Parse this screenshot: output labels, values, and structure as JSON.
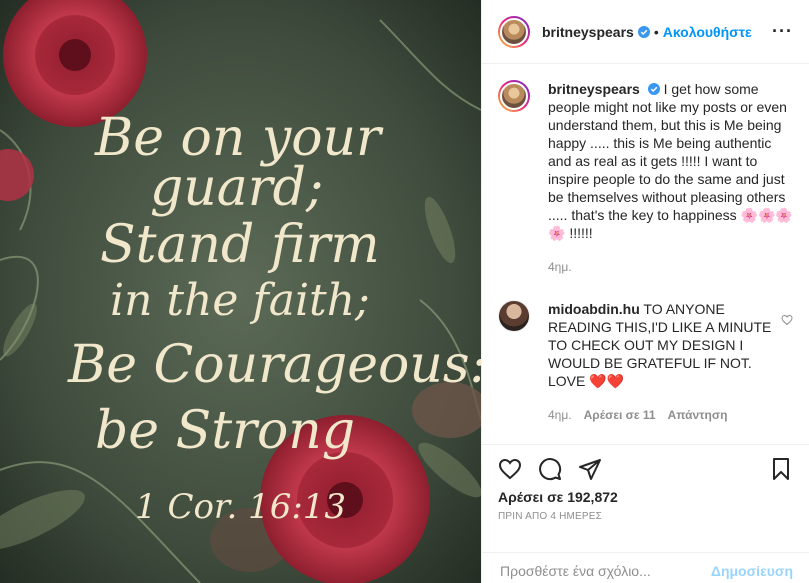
{
  "image": {
    "lines": [
      "Be on your",
      "guard;",
      "Stand firm",
      "in the faith;",
      "Be Courageous:",
      "be Strong",
      "1 Cor. 16:13"
    ],
    "colors": {
      "background": "#3d4a3c",
      "lettering": "#f1e8cc",
      "flower": "#b8283c"
    }
  },
  "header": {
    "username": "britneyspears",
    "verified_icon": "verified-badge-icon",
    "dot": "•",
    "follow_label": "Ακολουθήστε",
    "more_label": "···"
  },
  "caption": {
    "username": "britneyspears",
    "text": "I get how some people might not like my posts or even understand them, but this is Me being happy ..... this is Me being authentic and as real as it gets !!!!! I want to inspire people to do the same and just be themselves without pleasing others ..... that's the key to happiness 🌸🌸🌸🌸 !!!!!!",
    "time": "4ημ."
  },
  "comment": {
    "username": "midoabdin.hu",
    "text": "TO ANYONE READING THIS,I'D LIKE A MINUTE TO CHECK OUT MY DESIGN I WOULD BE GRATEFUL IF NOT. LOVE ❤️❤️",
    "time": "4ημ.",
    "likes": "Αρέσει σε 11",
    "reply": "Απάντηση"
  },
  "actions": {
    "like_icon": "heart-icon",
    "comment_icon": "comment-icon",
    "share_icon": "paper-plane-icon",
    "save_icon": "bookmark-icon"
  },
  "likes": "Αρέσει σε 192,872",
  "age": "ΠΡΙΝ ΑΠΟ 4 ΗΜΕΡΕΣ",
  "add_comment": {
    "placeholder": "Προσθέστε ένα σχόλιο...",
    "post_label": "Δημοσίευση"
  },
  "accent_color": "#0095f6"
}
